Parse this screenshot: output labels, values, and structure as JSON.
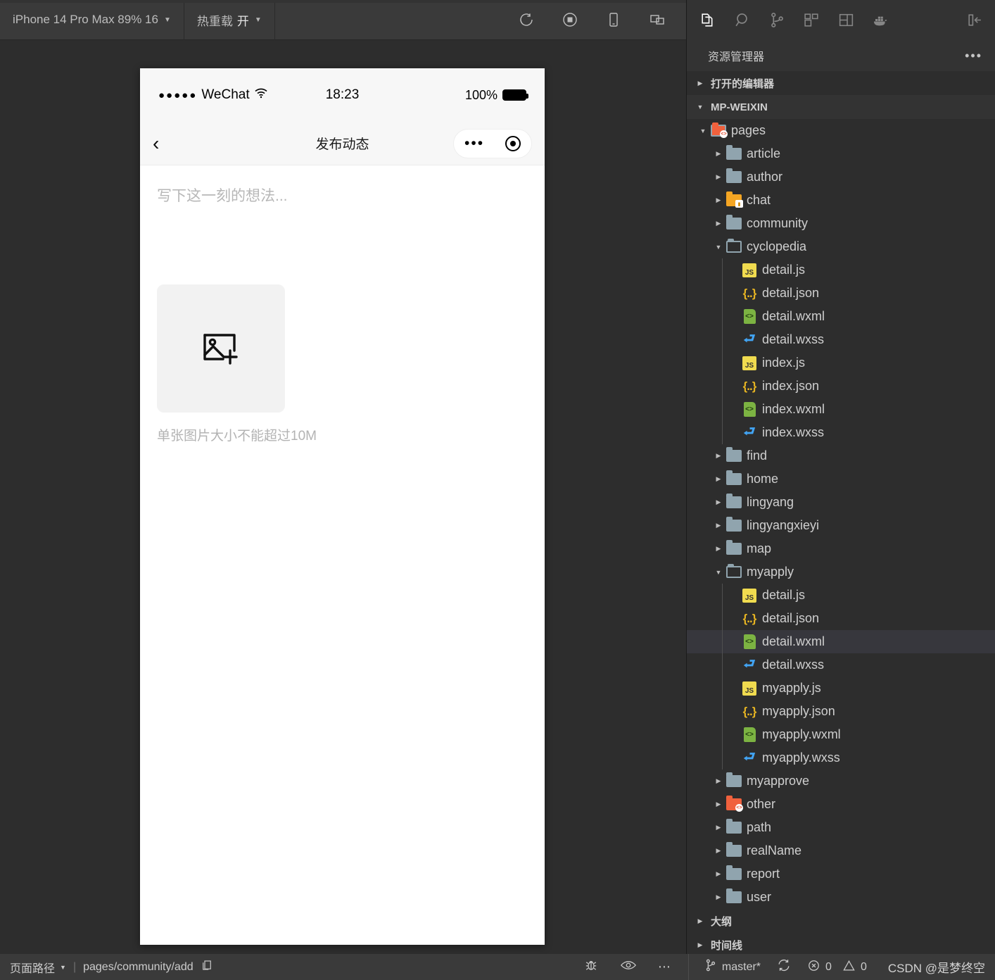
{
  "simulator": {
    "toolbar": {
      "device": "iPhone 14 Pro Max 89% 16",
      "hot_reload_label": "热重载",
      "hot_reload_value": "开",
      "icons": [
        "refresh-icon",
        "stop-record-icon",
        "device-icon",
        "multi-window-icon"
      ]
    },
    "phone": {
      "status": {
        "signal_dots": "●●●●●",
        "carrier": "WeChat",
        "time": "18:23",
        "battery_percent": "100%"
      },
      "nav": {
        "back_icon": "chevron-left-icon",
        "title": "发布动态",
        "capsule_more": "•••",
        "capsule_target_icon": "target-icon"
      },
      "content": {
        "compose_placeholder": "写下这一刻的想法...",
        "upload_icon": "add-image-icon",
        "upload_hint": "单张图片大小不能超过10M"
      }
    }
  },
  "vscode": {
    "activity_icons": [
      {
        "name": "explorer-icon",
        "active": true
      },
      {
        "name": "search-icon",
        "active": false
      },
      {
        "name": "source-control-icon",
        "active": false
      },
      {
        "name": "extensions-icon",
        "active": false
      },
      {
        "name": "editor-layout-icon",
        "active": false
      },
      {
        "name": "docker-icon",
        "active": false
      }
    ],
    "collapse_icon": "collapse-sidebar-icon",
    "panel_title": "资源管理器",
    "panel_more": "•••",
    "sections": {
      "open_editors": "打开的编辑器",
      "workspace": "MP-WEIXIN",
      "outline": "大纲",
      "timeline": "时间线"
    },
    "tree": [
      {
        "label": "pages",
        "depth": 1,
        "kind": "folder-red",
        "state": "open",
        "selected": false
      },
      {
        "label": "article",
        "depth": 2,
        "kind": "folder",
        "state": "closed",
        "selected": false
      },
      {
        "label": "author",
        "depth": 2,
        "kind": "folder",
        "state": "closed",
        "selected": false
      },
      {
        "label": "chat",
        "depth": 2,
        "kind": "folder-orange",
        "state": "closed",
        "selected": false
      },
      {
        "label": "community",
        "depth": 2,
        "kind": "folder",
        "state": "closed",
        "selected": false
      },
      {
        "label": "cyclopedia",
        "depth": 2,
        "kind": "folder",
        "state": "open",
        "selected": false
      },
      {
        "label": "detail.js",
        "depth": 3,
        "kind": "js",
        "state": "none",
        "selected": false
      },
      {
        "label": "detail.json",
        "depth": 3,
        "kind": "json",
        "state": "none",
        "selected": false
      },
      {
        "label": "detail.wxml",
        "depth": 3,
        "kind": "wxml",
        "state": "none",
        "selected": false
      },
      {
        "label": "detail.wxss",
        "depth": 3,
        "kind": "wxss",
        "state": "none",
        "selected": false
      },
      {
        "label": "index.js",
        "depth": 3,
        "kind": "js",
        "state": "none",
        "selected": false
      },
      {
        "label": "index.json",
        "depth": 3,
        "kind": "json",
        "state": "none",
        "selected": false
      },
      {
        "label": "index.wxml",
        "depth": 3,
        "kind": "wxml",
        "state": "none",
        "selected": false
      },
      {
        "label": "index.wxss",
        "depth": 3,
        "kind": "wxss",
        "state": "none",
        "selected": false
      },
      {
        "label": "find",
        "depth": 2,
        "kind": "folder",
        "state": "closed",
        "selected": false
      },
      {
        "label": "home",
        "depth": 2,
        "kind": "folder",
        "state": "closed",
        "selected": false
      },
      {
        "label": "lingyang",
        "depth": 2,
        "kind": "folder",
        "state": "closed",
        "selected": false
      },
      {
        "label": "lingyangxieyi",
        "depth": 2,
        "kind": "folder",
        "state": "closed",
        "selected": false
      },
      {
        "label": "map",
        "depth": 2,
        "kind": "folder",
        "state": "closed",
        "selected": false
      },
      {
        "label": "myapply",
        "depth": 2,
        "kind": "folder",
        "state": "open",
        "selected": false
      },
      {
        "label": "detail.js",
        "depth": 3,
        "kind": "js",
        "state": "none",
        "selected": false
      },
      {
        "label": "detail.json",
        "depth": 3,
        "kind": "json",
        "state": "none",
        "selected": false
      },
      {
        "label": "detail.wxml",
        "depth": 3,
        "kind": "wxml",
        "state": "none",
        "selected": true
      },
      {
        "label": "detail.wxss",
        "depth": 3,
        "kind": "wxss",
        "state": "none",
        "selected": false
      },
      {
        "label": "myapply.js",
        "depth": 3,
        "kind": "js",
        "state": "none",
        "selected": false
      },
      {
        "label": "myapply.json",
        "depth": 3,
        "kind": "json",
        "state": "none",
        "selected": false
      },
      {
        "label": "myapply.wxml",
        "depth": 3,
        "kind": "wxml",
        "state": "none",
        "selected": false
      },
      {
        "label": "myapply.wxss",
        "depth": 3,
        "kind": "wxss",
        "state": "none",
        "selected": false
      },
      {
        "label": "myapprove",
        "depth": 2,
        "kind": "folder",
        "state": "closed",
        "selected": false
      },
      {
        "label": "other",
        "depth": 2,
        "kind": "folder-red",
        "state": "closed",
        "selected": false
      },
      {
        "label": "path",
        "depth": 2,
        "kind": "folder",
        "state": "closed",
        "selected": false
      },
      {
        "label": "realName",
        "depth": 2,
        "kind": "folder",
        "state": "closed",
        "selected": false
      },
      {
        "label": "report",
        "depth": 2,
        "kind": "folder",
        "state": "closed",
        "selected": false
      },
      {
        "label": "user",
        "depth": 2,
        "kind": "folder",
        "state": "closed",
        "selected": false
      }
    ]
  },
  "statusbar": {
    "page_path_label": "页面路径",
    "separator": "|",
    "page_path_value": "pages/community/add",
    "copy_icon": "copy-icon",
    "debug_icon": "bug-icon",
    "preview_icon": "eye-icon",
    "more_icon": "more-icon",
    "branch_icon": "source-control-icon",
    "branch": "master*",
    "sync_icon": "sync-icon",
    "errors": "0",
    "warnings": "0",
    "watermark": "CSDN @是梦终空"
  }
}
